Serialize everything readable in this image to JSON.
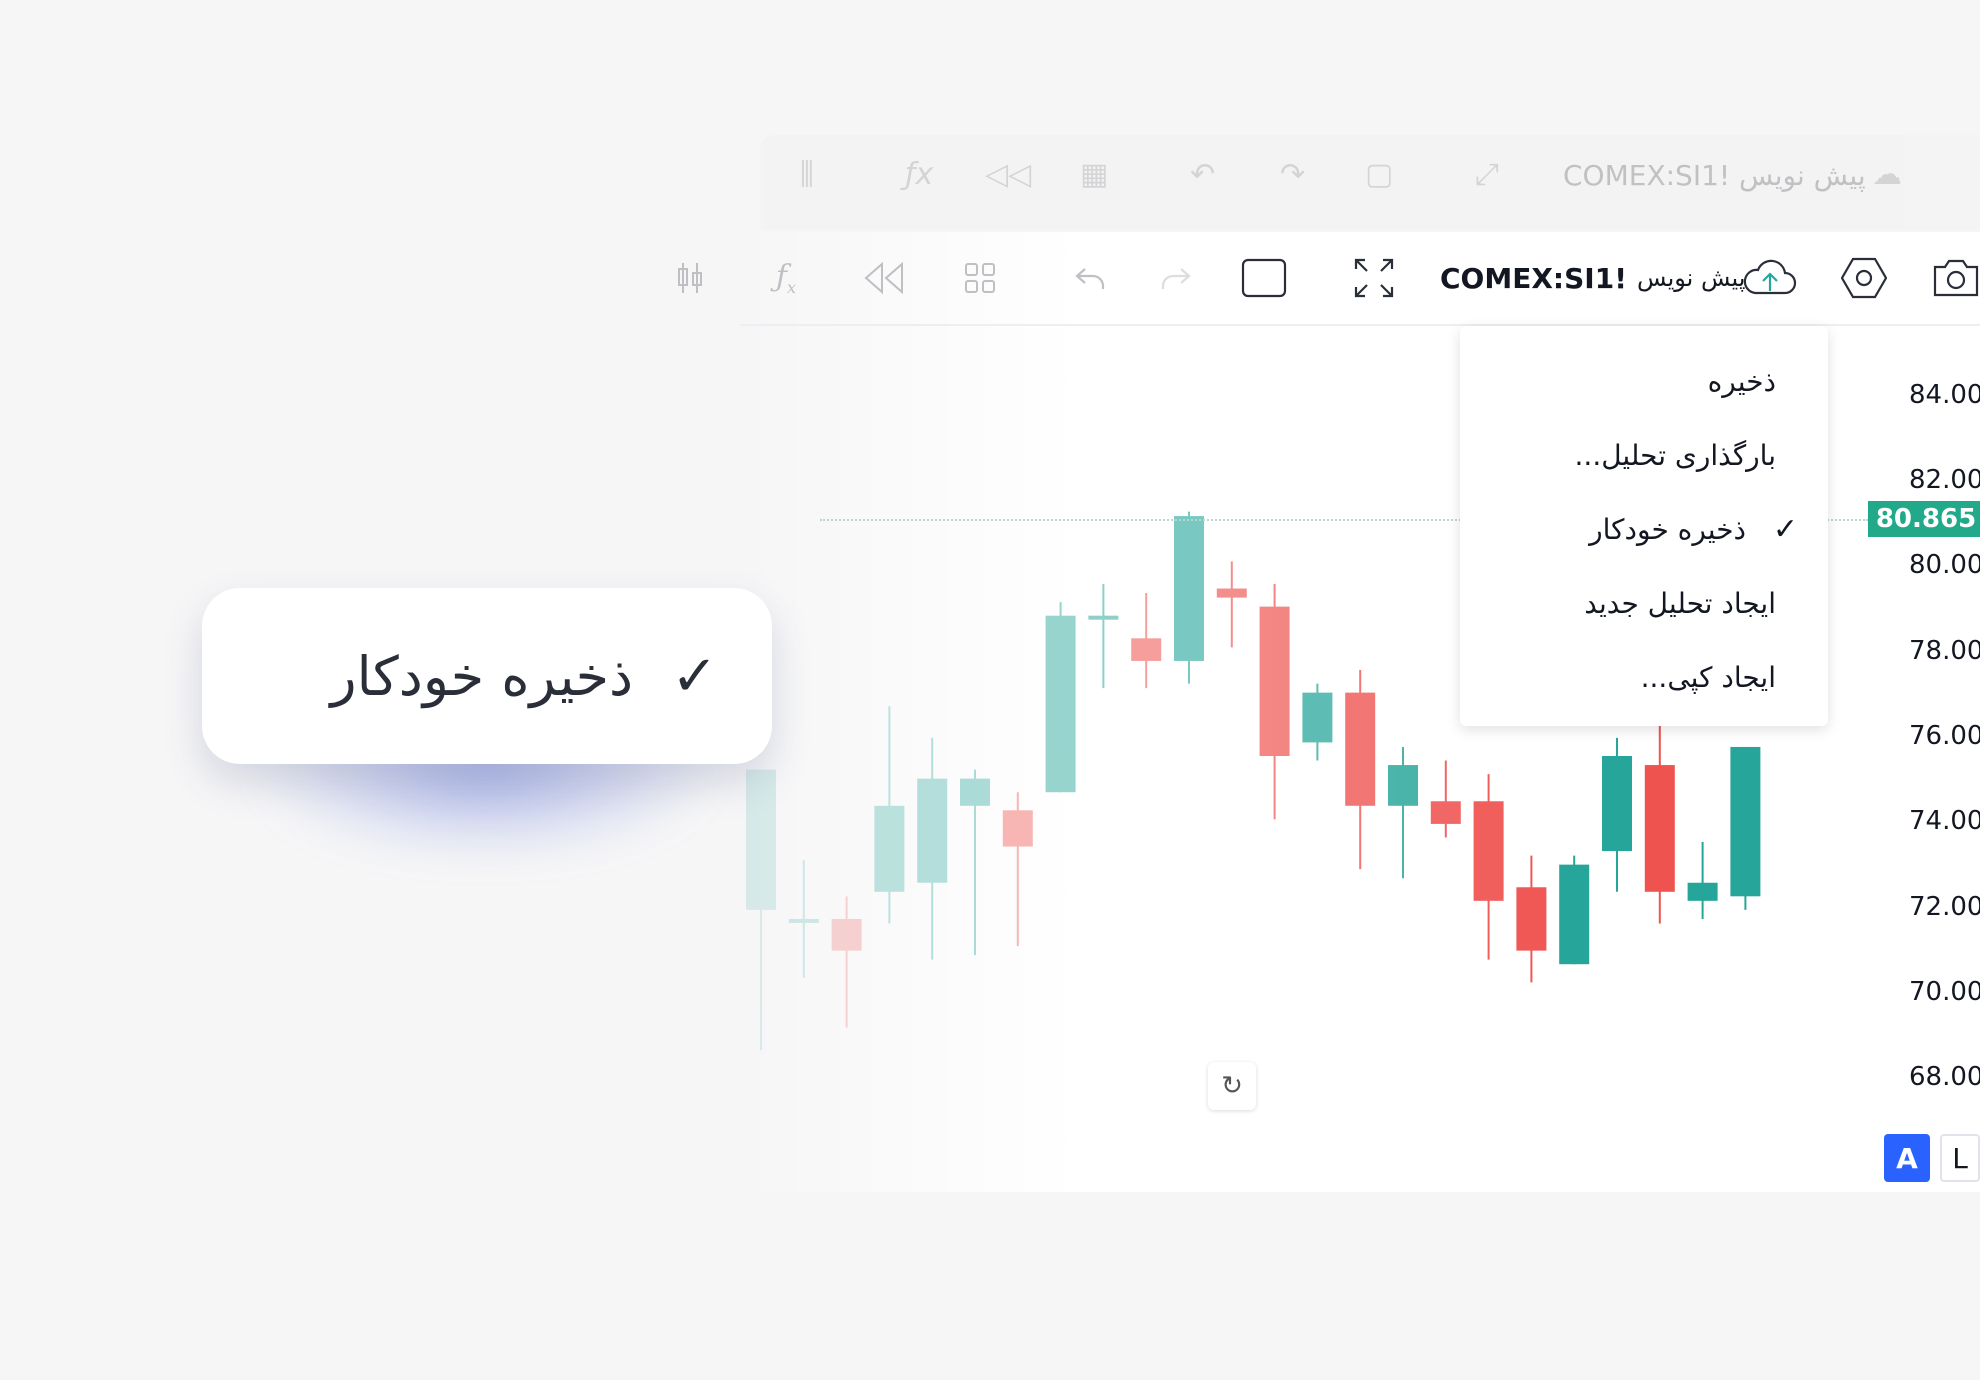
{
  "ghost_toolbar": {
    "symbol": "COMEX:SI1!",
    "subtitle": "پیش نویس"
  },
  "toolbar": {
    "symbol": "COMEX:SI1!",
    "subtitle": "پیش نویس"
  },
  "menu": {
    "items": [
      {
        "label": "ذخیره",
        "checked": false
      },
      {
        "label": "بارگذاری تحلیل...",
        "checked": false
      },
      {
        "label": "ذخیره خودکار",
        "checked": true
      },
      {
        "label": "ایجاد تحلیل جدید",
        "checked": false
      },
      {
        "label": "ایجاد کپی...",
        "checked": false
      }
    ],
    "check_glyph": "✓"
  },
  "price_axis": {
    "ticks": [
      "84.000",
      "82.000",
      "80.000",
      "78.000",
      "76.000",
      "74.000",
      "72.000",
      "70.000",
      "68.000"
    ],
    "last_price": "80.865",
    "last_price_color": "#22a98a"
  },
  "bottom": {
    "auto_label": "A",
    "log_label": "L"
  },
  "callout": {
    "check": "✓",
    "label": "ذخیره خودکار"
  },
  "colors": {
    "up": "#26a69a",
    "down": "#ef5350",
    "accent": "#2962ff"
  },
  "chart_data": {
    "type": "candlestick",
    "ylim": [
      67,
      86
    ],
    "candles": [
      {
        "o": 73.1,
        "h": 74.4,
        "l": 70.0,
        "c": 76.2
      },
      {
        "o": 72.9,
        "h": 74.2,
        "l": 71.6,
        "c": 72.9
      },
      {
        "o": 72.9,
        "h": 73.4,
        "l": 70.5,
        "c": 72.2
      },
      {
        "o": 73.5,
        "h": 77.6,
        "l": 72.8,
        "c": 75.4
      },
      {
        "o": 73.7,
        "h": 76.9,
        "l": 72.0,
        "c": 76.0
      },
      {
        "o": 75.4,
        "h": 76.2,
        "l": 72.1,
        "c": 76.0
      },
      {
        "o": 75.3,
        "h": 75.7,
        "l": 72.3,
        "c": 74.5
      },
      {
        "o": 75.7,
        "h": 79.9,
        "l": 75.7,
        "c": 79.6
      },
      {
        "o": 79.6,
        "h": 80.3,
        "l": 78.0,
        "c": 79.6
      },
      {
        "o": 79.1,
        "h": 80.1,
        "l": 78.0,
        "c": 78.6
      },
      {
        "o": 78.6,
        "h": 81.9,
        "l": 78.1,
        "c": 81.8
      },
      {
        "o": 80.2,
        "h": 80.8,
        "l": 78.9,
        "c": 80.0
      },
      {
        "o": 79.8,
        "h": 80.3,
        "l": 75.1,
        "c": 76.5
      },
      {
        "o": 76.8,
        "h": 78.1,
        "l": 76.4,
        "c": 77.9
      },
      {
        "o": 77.9,
        "h": 78.4,
        "l": 74.0,
        "c": 75.4
      },
      {
        "o": 75.4,
        "h": 76.7,
        "l": 73.8,
        "c": 76.3
      },
      {
        "o": 75.5,
        "h": 76.4,
        "l": 74.7,
        "c": 75.0
      },
      {
        "o": 75.5,
        "h": 76.1,
        "l": 72.0,
        "c": 73.3
      },
      {
        "o": 73.6,
        "h": 74.3,
        "l": 71.5,
        "c": 72.2
      },
      {
        "o": 71.9,
        "h": 74.3,
        "l": 71.9,
        "c": 74.1
      },
      {
        "o": 74.4,
        "h": 76.9,
        "l": 73.5,
        "c": 76.5
      },
      {
        "o": 76.3,
        "h": 77.9,
        "l": 72.8,
        "c": 73.5
      },
      {
        "o": 73.3,
        "h": 74.6,
        "l": 72.9,
        "c": 73.7
      },
      {
        "o": 73.4,
        "h": 76.0,
        "l": 73.1,
        "c": 76.7
      }
    ]
  }
}
